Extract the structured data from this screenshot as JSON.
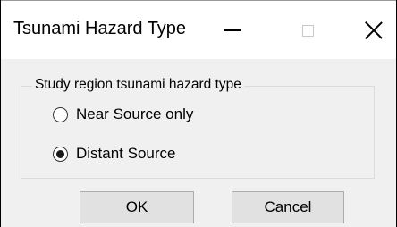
{
  "window": {
    "title": "Tsunami Hazard Type",
    "controls": {
      "minimize_icon": "minimize-icon",
      "maximize_icon": "maximize-icon",
      "close_icon": "close-icon"
    }
  },
  "group": {
    "legend": "Study region tsunami hazard type",
    "options": [
      {
        "label": "Near Source only",
        "selected": false
      },
      {
        "label": "Distant Source",
        "selected": true
      }
    ]
  },
  "buttons": {
    "ok_label": "OK",
    "cancel_label": "Cancel"
  },
  "colors": {
    "dialog_background": "#f0f0f0",
    "titlebar_background": "#ffffff",
    "button_background": "#e1e1e1",
    "button_border": "#adadad"
  }
}
